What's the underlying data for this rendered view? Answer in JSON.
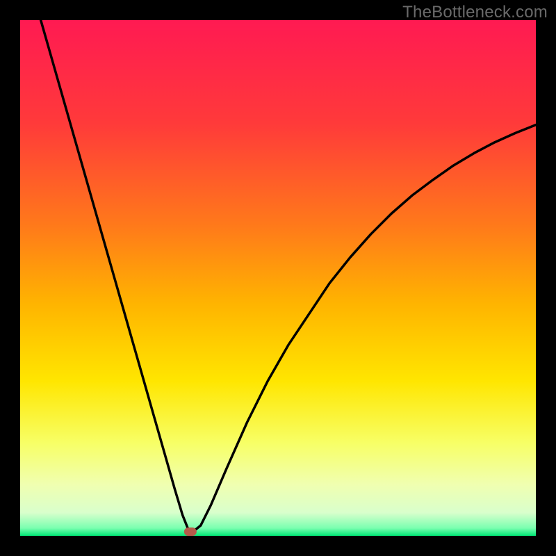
{
  "watermark": "TheBottleneck.com",
  "chart_data": {
    "type": "line",
    "title": "",
    "xlabel": "",
    "ylabel": "",
    "xlim": [
      0,
      100
    ],
    "ylim": [
      0,
      100
    ],
    "gradient_stops": [
      {
        "offset": 0.0,
        "color": "#ff1a52"
      },
      {
        "offset": 0.2,
        "color": "#ff3a3a"
      },
      {
        "offset": 0.4,
        "color": "#ff7a1a"
      },
      {
        "offset": 0.55,
        "color": "#ffb400"
      },
      {
        "offset": 0.7,
        "color": "#ffe600"
      },
      {
        "offset": 0.82,
        "color": "#f7ff66"
      },
      {
        "offset": 0.9,
        "color": "#f0ffb0"
      },
      {
        "offset": 0.955,
        "color": "#d9ffcc"
      },
      {
        "offset": 0.985,
        "color": "#7affb0"
      },
      {
        "offset": 1.0,
        "color": "#00e676"
      }
    ],
    "series": [
      {
        "name": "bottleneck-curve",
        "type": "line",
        "x": [
          4,
          6,
          8,
          10,
          12,
          14,
          16,
          18,
          20,
          22,
          24,
          26,
          28,
          30,
          31.5,
          32.5,
          33.5,
          35,
          37,
          40,
          44,
          48,
          52,
          56,
          60,
          64,
          68,
          72,
          76,
          80,
          84,
          88,
          92,
          96,
          100
        ],
        "values": [
          100,
          93,
          86,
          79,
          72,
          65,
          58,
          51,
          44,
          37,
          30,
          23,
          16,
          9,
          4,
          1.5,
          0.8,
          2,
          6,
          13,
          22,
          30,
          37,
          43,
          49,
          54,
          58.5,
          62.5,
          66,
          69,
          71.8,
          74.2,
          76.3,
          78.1,
          79.7
        ]
      }
    ],
    "marker": {
      "x": 33,
      "y": 0.8,
      "color": "#b55a4a"
    },
    "colors": {
      "curve": "#000000",
      "frame": "#000000",
      "marker": "#b55a4a"
    }
  }
}
